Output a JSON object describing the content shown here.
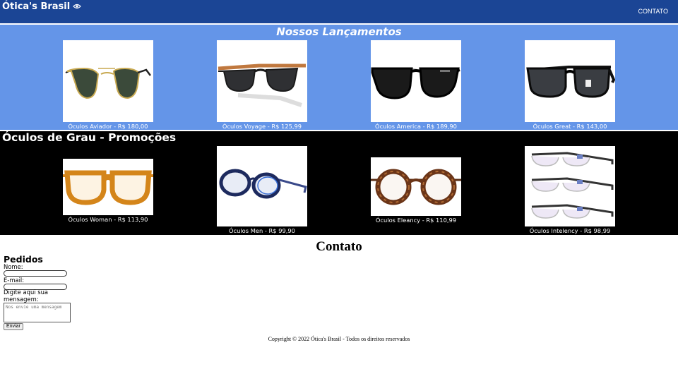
{
  "header": {
    "brand": "Ótica's Brasil",
    "brand_icon": "eye-icon",
    "nav_contact": "CONTATO",
    "color": "#1b4595"
  },
  "launches": {
    "title": "Nossos Lançamentos",
    "color": "#6495e8",
    "items": [
      {
        "caption": "Óculos Aviador - R$ 180,00"
      },
      {
        "caption": "Óculos Voyage - R$ 125,99"
      },
      {
        "caption": "Óculos America - R$ 189,90"
      },
      {
        "caption": "Óculos Great - R$ 143,00"
      }
    ]
  },
  "promos": {
    "title": "Óculos de Grau - Promoções",
    "color": "#000000",
    "items": [
      {
        "caption": "Óculos Woman - R$ 113,90"
      },
      {
        "caption": "Óculos Men - R$ 99,90"
      },
      {
        "caption": "Óculos Eleancy - R$ 110,99"
      },
      {
        "caption": "Óculos Intelency - R$ 98,99"
      }
    ]
  },
  "contact": {
    "title": "Contato",
    "form_title": "Pedidos",
    "name_label": "Nome:",
    "email_label": "E-mail:",
    "message_label": "Digite aqui sua mensagem:",
    "message_label_l1": "Digite aqui sua",
    "message_label_l2": "mensagem:",
    "message_placeholder": "Nos envie uma mensagem",
    "submit_label": "Enviar"
  },
  "footer": {
    "copyright": "Copyright © 2022 Ótica's Brasil - Todos os direitos reservados"
  }
}
